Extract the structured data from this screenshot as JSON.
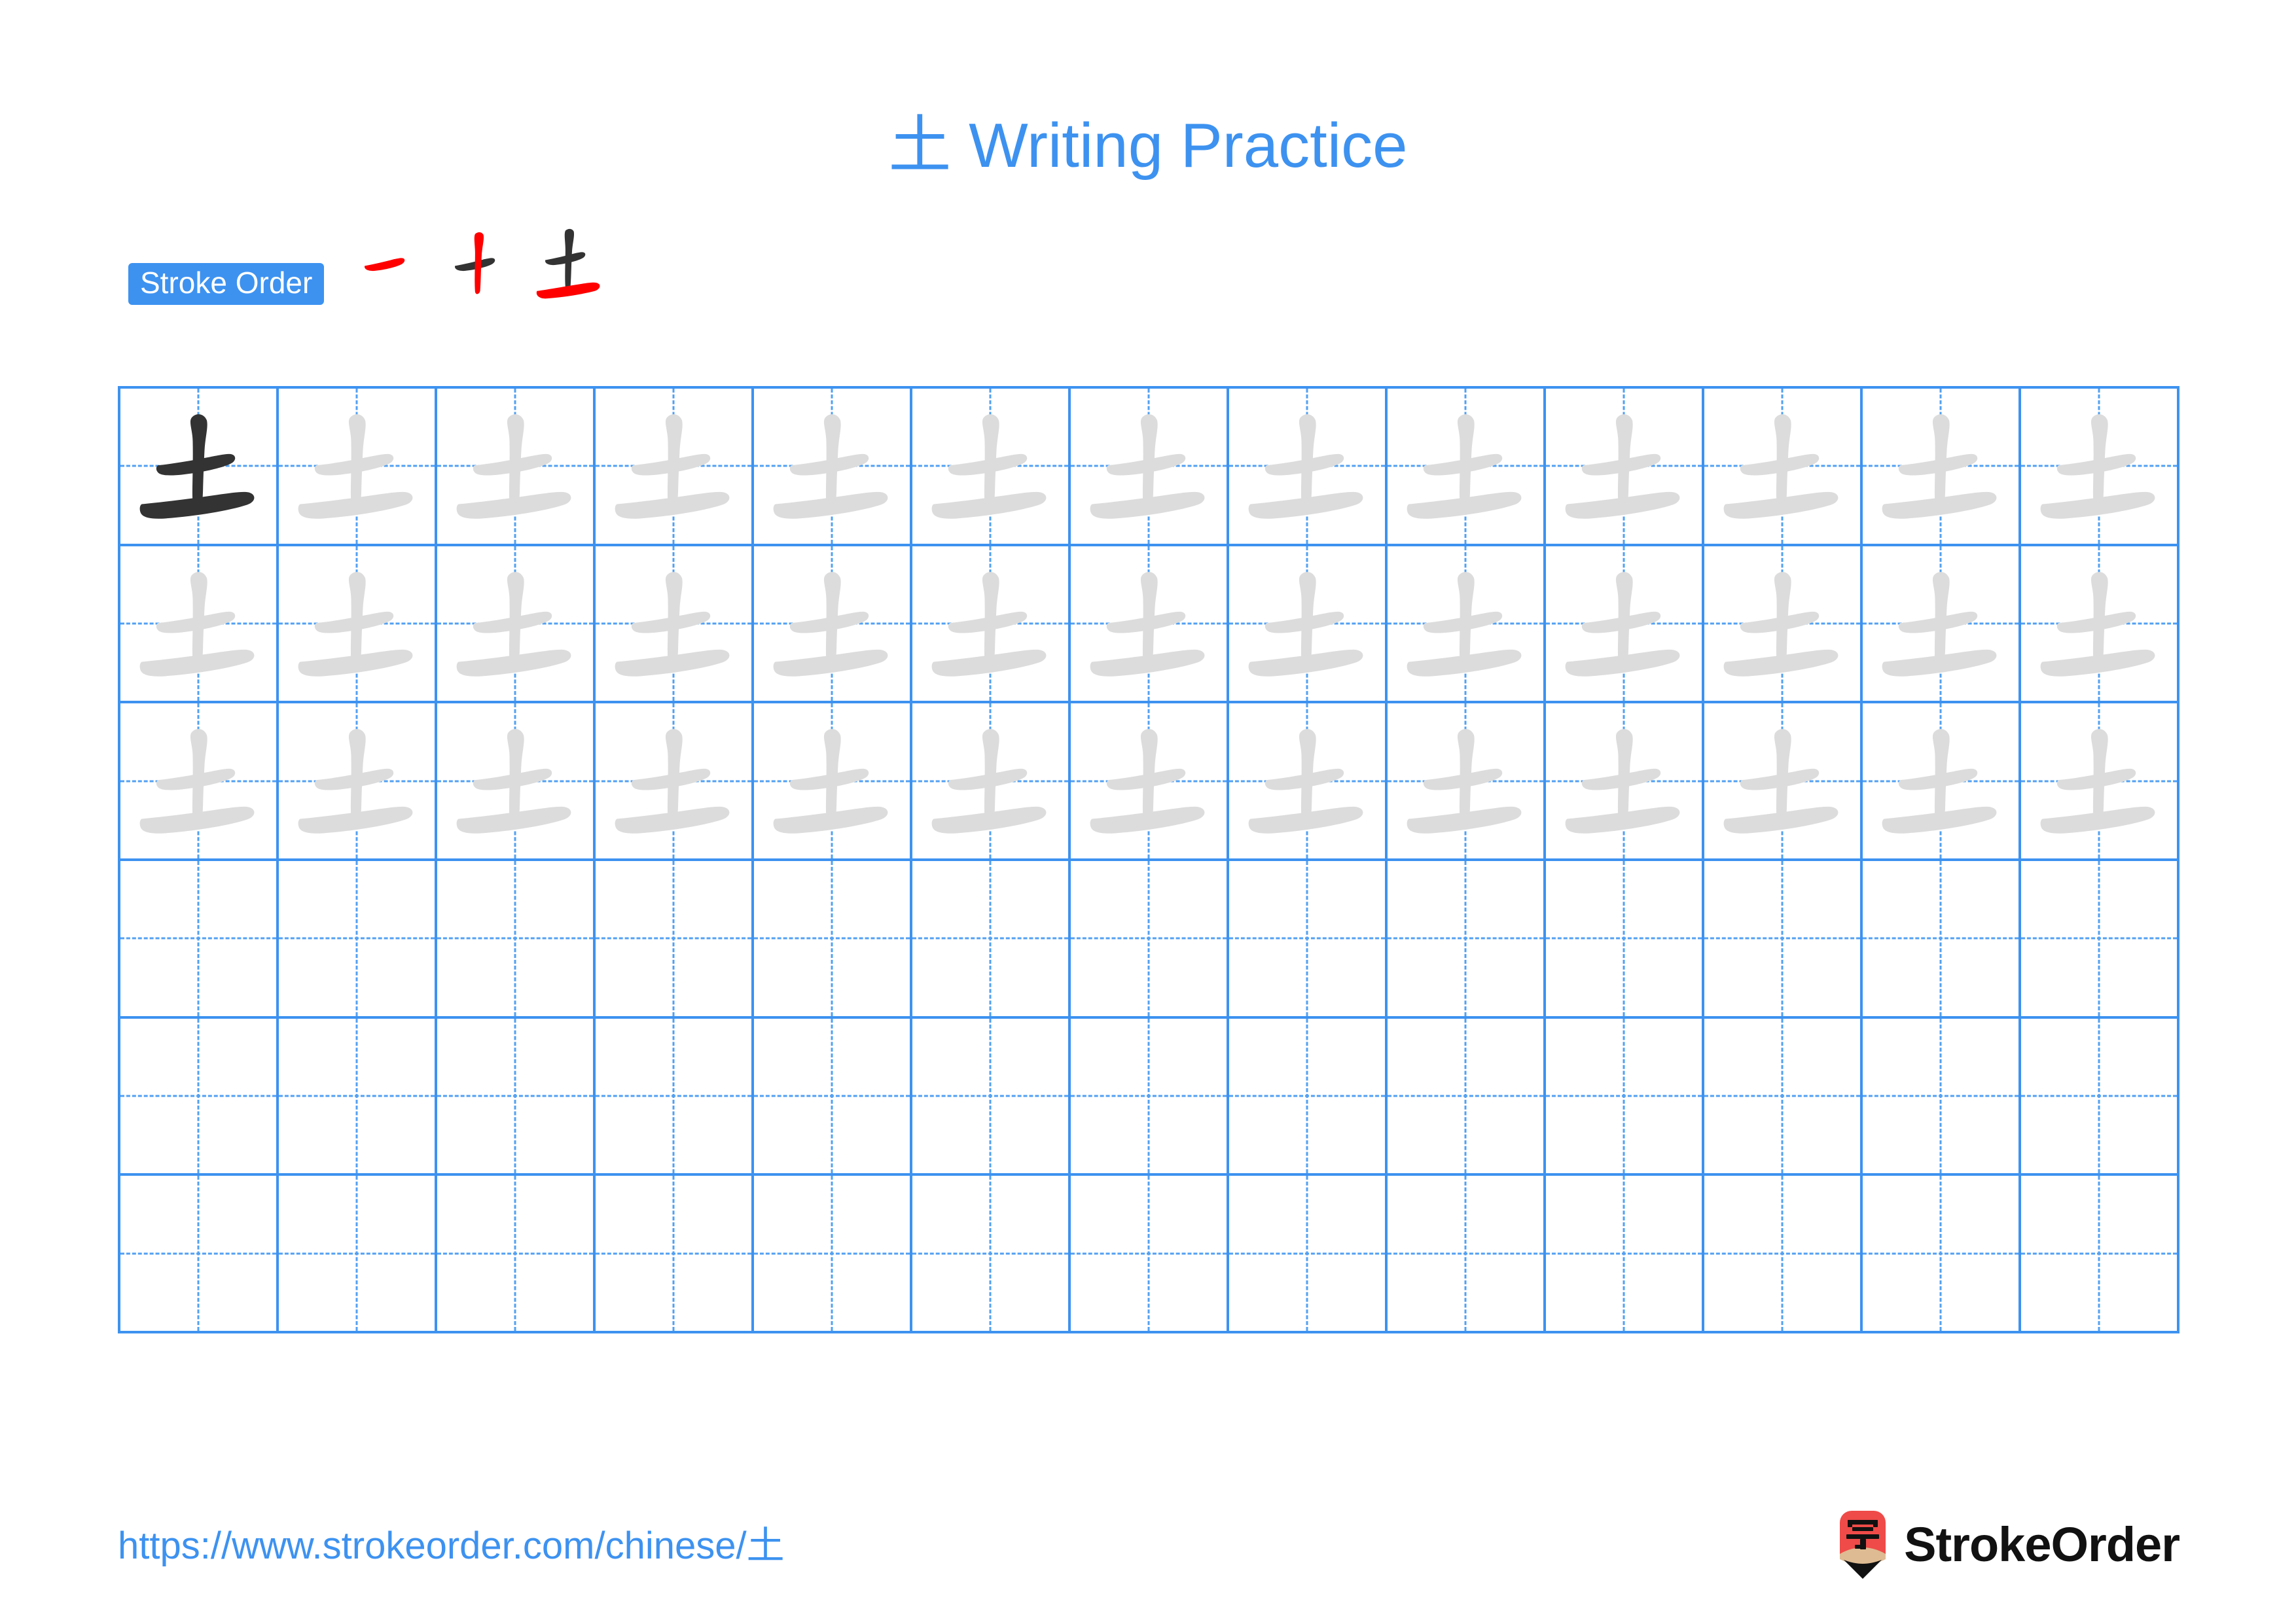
{
  "page": {
    "character": "土",
    "title": "土 Writing Practice",
    "title_character": "土",
    "title_text": "Writing Practice",
    "background_color": "#ffffff",
    "accent_color": "#3d92f0",
    "grid_line_color": "#3d92f0",
    "guide_line_color": "#52a0f2",
    "model_char_color": "#333333",
    "trace_char_color": "#dcdcdc",
    "highlight_stroke_color": "#ff0000"
  },
  "stroke_order": {
    "label": "Stroke Order",
    "badge_bg": "#3d92f0",
    "badge_text_color": "#ffffff",
    "total_strokes": 3,
    "steps": [
      {
        "step": 1,
        "new_stroke": "horizontal",
        "completed_strokes": 0
      },
      {
        "step": 2,
        "new_stroke": "vertical",
        "completed_strokes": 1
      },
      {
        "step": 3,
        "new_stroke": "bottom-horizontal",
        "completed_strokes": 2
      }
    ]
  },
  "grid": {
    "columns": 13,
    "rows": 6,
    "model_cell": {
      "row": 1,
      "column": 1
    },
    "rows_detail": [
      {
        "row": 1,
        "type": "trace",
        "filled_columns": 13
      },
      {
        "row": 2,
        "type": "trace",
        "filled_columns": 13
      },
      {
        "row": 3,
        "type": "trace",
        "filled_columns": 13
      },
      {
        "row": 4,
        "type": "blank",
        "filled_columns": 0
      },
      {
        "row": 5,
        "type": "blank",
        "filled_columns": 0
      },
      {
        "row": 6,
        "type": "blank",
        "filled_columns": 0
      }
    ]
  },
  "footer": {
    "url": "https://www.strokeorder.com/chinese/土",
    "brand_name": "StrokeOrder",
    "logo_character": "字",
    "logo_body_color": "#ef4b48",
    "logo_wood_color": "#debb92",
    "logo_tip_color": "#111111"
  }
}
